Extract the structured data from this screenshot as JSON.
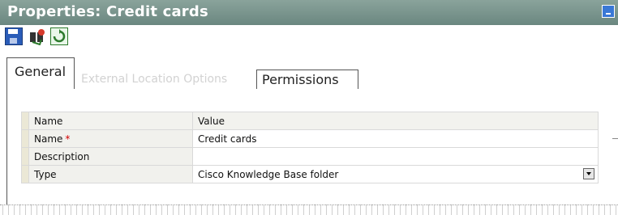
{
  "window": {
    "title": "Properties: Credit cards"
  },
  "toolbar": {
    "icons": [
      "save-icon",
      "search-replace-icon",
      "refresh-icon"
    ]
  },
  "tabs": [
    {
      "label": "General",
      "state": "active"
    },
    {
      "label": "External Location Options",
      "state": "disabled"
    },
    {
      "label": "Permissions",
      "state": "inactive"
    }
  ],
  "grid": {
    "headers": {
      "name": "Name",
      "value": "Value"
    },
    "rows": [
      {
        "name": "Name",
        "required": "*",
        "value": "Credit cards"
      },
      {
        "name": "Description",
        "value": ""
      },
      {
        "name": "Type",
        "value": "Cisco Knowledge Base folder"
      }
    ]
  },
  "colors": {
    "titlebar": "#7a948d",
    "gutter": "#ebe8d6",
    "required": "#d40000"
  }
}
